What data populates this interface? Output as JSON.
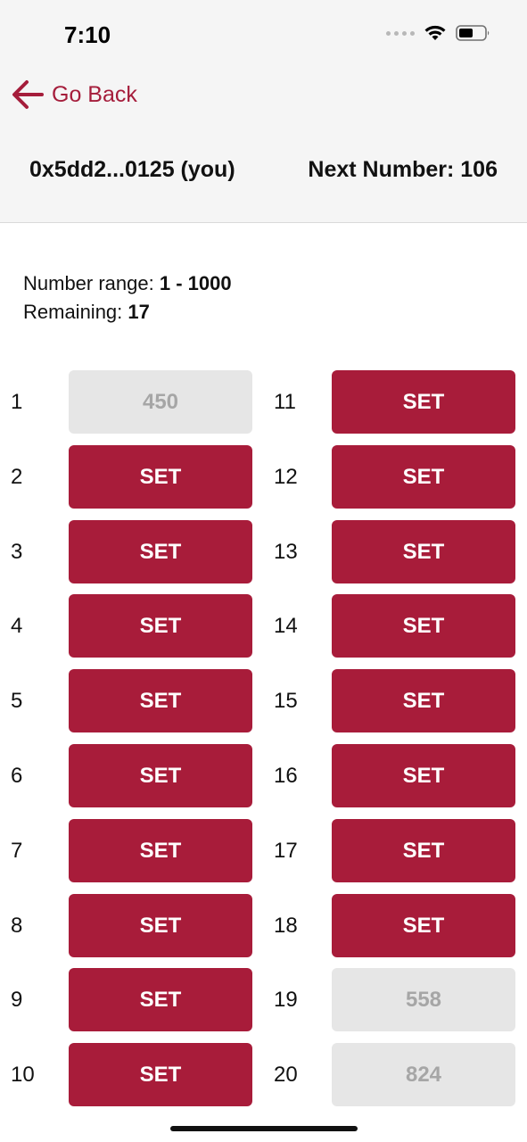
{
  "status_bar": {
    "time": "7:10"
  },
  "header": {
    "back_label": "Go Back",
    "account": "0x5dd2...0125 (you)",
    "next_number_label": "Next Number:",
    "next_number_value": "106"
  },
  "info": {
    "range_label": "Number range:",
    "range_value": "1 - 1000",
    "remaining_label": "Remaining:",
    "remaining_value": "17"
  },
  "colors": {
    "accent": "#a81c3a",
    "link": "#a51d3b",
    "filled_bg": "#e6e6e6",
    "filled_text": "#a6a6a6"
  },
  "icons": {
    "back": "arrow-left-icon",
    "signal": "signal-icon",
    "wifi": "wifi-icon",
    "battery": "battery-icon"
  },
  "slots": [
    {
      "number": "1",
      "label": "450",
      "state": "filled"
    },
    {
      "number": "2",
      "label": "SET",
      "state": "set"
    },
    {
      "number": "3",
      "label": "SET",
      "state": "set"
    },
    {
      "number": "4",
      "label": "SET",
      "state": "set"
    },
    {
      "number": "5",
      "label": "SET",
      "state": "set"
    },
    {
      "number": "6",
      "label": "SET",
      "state": "set"
    },
    {
      "number": "7",
      "label": "SET",
      "state": "set"
    },
    {
      "number": "8",
      "label": "SET",
      "state": "set"
    },
    {
      "number": "9",
      "label": "SET",
      "state": "set"
    },
    {
      "number": "10",
      "label": "SET",
      "state": "set"
    },
    {
      "number": "11",
      "label": "SET",
      "state": "set"
    },
    {
      "number": "12",
      "label": "SET",
      "state": "set"
    },
    {
      "number": "13",
      "label": "SET",
      "state": "set"
    },
    {
      "number": "14",
      "label": "SET",
      "state": "set"
    },
    {
      "number": "15",
      "label": "SET",
      "state": "set"
    },
    {
      "number": "16",
      "label": "SET",
      "state": "set"
    },
    {
      "number": "17",
      "label": "SET",
      "state": "set"
    },
    {
      "number": "18",
      "label": "SET",
      "state": "set"
    },
    {
      "number": "19",
      "label": "558",
      "state": "filled"
    },
    {
      "number": "20",
      "label": "824",
      "state": "filled"
    }
  ]
}
